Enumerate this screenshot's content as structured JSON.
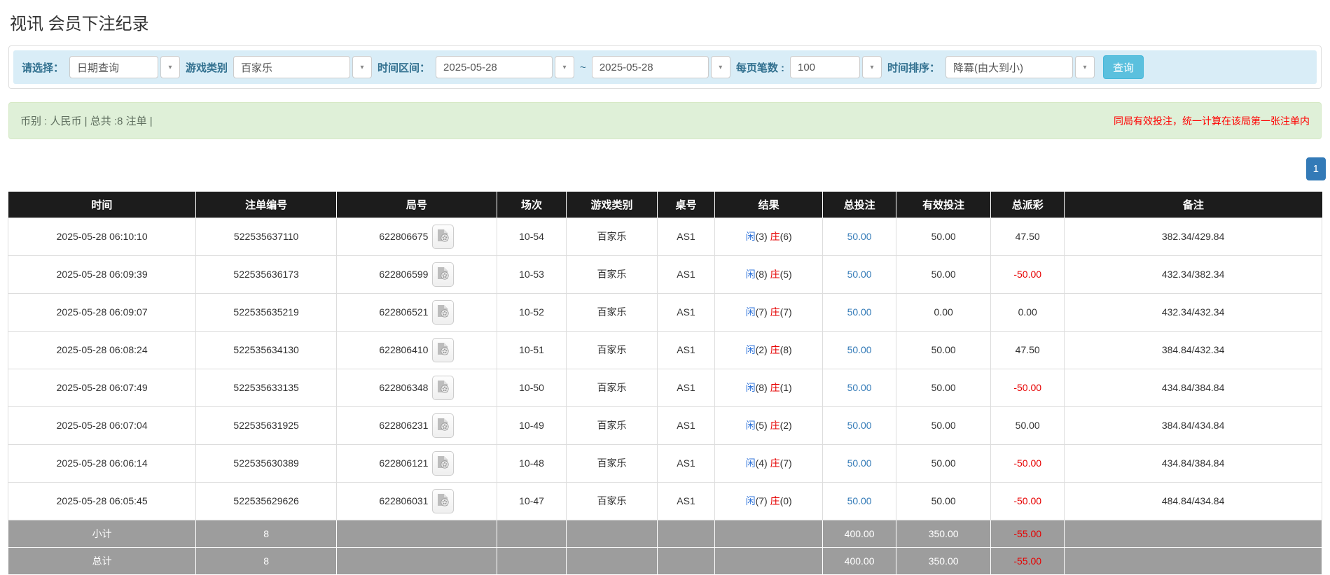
{
  "page": {
    "title": "视讯 会员下注纪录"
  },
  "filters": {
    "select_label": "请选择：",
    "select_value": "日期查询",
    "game_label": "游戏类别",
    "game_value": "百家乐",
    "range_label": "时间区间：",
    "date_from": "2025-05-28",
    "range_separator": "~",
    "date_to": "2025-05-28",
    "per_page_label": "每页笔数 :",
    "per_page_value": "100",
    "sort_label": "时间排序：",
    "sort_value": "降冪(由大到小)",
    "search_button": "查询"
  },
  "summary": {
    "left_text": "币别 : 人民币 | 总共 :8 注单 |",
    "right_note": "同局有效投注，统一计算在该局第一张注单内"
  },
  "pagination": {
    "current_page": "1"
  },
  "icons": {
    "caret": "▾",
    "video_icon_name": "video-record-icon"
  },
  "colors": {
    "filter_bg": "#d9edf7",
    "accent_blue": "#5bc0de",
    "link_blue": "#337ab7",
    "player_blue": "#2d72d9",
    "banker_red": "#e60000",
    "negative_red": "#e60000",
    "summary_bg": "#dff0d8",
    "note_red": "#ff0000",
    "header_bg": "#1c1c1c",
    "footer_bg": "#9d9d9d",
    "pagination_blue": "#337ab7"
  },
  "table": {
    "headers": [
      "时间",
      "注单编号",
      "局号",
      "场次",
      "游戏类别",
      "桌号",
      "结果",
      "总投注",
      "有效投注",
      "总派彩",
      "备注"
    ],
    "result_player_label": "闲",
    "result_banker_label": "庄",
    "rows": [
      {
        "time": "2025-05-28 06:10:10",
        "bet_id": "522535637110",
        "round_id": "622806675",
        "session": "10-54",
        "game": "百家乐",
        "table": "AS1",
        "player_num": "3",
        "banker_num": "6",
        "total_bet": "50.00",
        "valid_bet": "50.00",
        "payout": "47.50",
        "remark": "382.34/429.84"
      },
      {
        "time": "2025-05-28 06:09:39",
        "bet_id": "522535636173",
        "round_id": "622806599",
        "session": "10-53",
        "game": "百家乐",
        "table": "AS1",
        "player_num": "8",
        "banker_num": "5",
        "total_bet": "50.00",
        "valid_bet": "50.00",
        "payout": "-50.00",
        "remark": "432.34/382.34"
      },
      {
        "time": "2025-05-28 06:09:07",
        "bet_id": "522535635219",
        "round_id": "622806521",
        "session": "10-52",
        "game": "百家乐",
        "table": "AS1",
        "player_num": "7",
        "banker_num": "7",
        "total_bet": "50.00",
        "valid_bet": "0.00",
        "payout": "0.00",
        "remark": "432.34/432.34"
      },
      {
        "time": "2025-05-28 06:08:24",
        "bet_id": "522535634130",
        "round_id": "622806410",
        "session": "10-51",
        "game": "百家乐",
        "table": "AS1",
        "player_num": "2",
        "banker_num": "8",
        "total_bet": "50.00",
        "valid_bet": "50.00",
        "payout": "47.50",
        "remark": "384.84/432.34"
      },
      {
        "time": "2025-05-28 06:07:49",
        "bet_id": "522535633135",
        "round_id": "622806348",
        "session": "10-50",
        "game": "百家乐",
        "table": "AS1",
        "player_num": "8",
        "banker_num": "1",
        "total_bet": "50.00",
        "valid_bet": "50.00",
        "payout": "-50.00",
        "remark": "434.84/384.84"
      },
      {
        "time": "2025-05-28 06:07:04",
        "bet_id": "522535631925",
        "round_id": "622806231",
        "session": "10-49",
        "game": "百家乐",
        "table": "AS1",
        "player_num": "5",
        "banker_num": "2",
        "total_bet": "50.00",
        "valid_bet": "50.00",
        "payout": "50.00",
        "remark": "384.84/434.84"
      },
      {
        "time": "2025-05-28 06:06:14",
        "bet_id": "522535630389",
        "round_id": "622806121",
        "session": "10-48",
        "game": "百家乐",
        "table": "AS1",
        "player_num": "4",
        "banker_num": "7",
        "total_bet": "50.00",
        "valid_bet": "50.00",
        "payout": "-50.00",
        "remark": "434.84/384.84"
      },
      {
        "time": "2025-05-28 06:05:45",
        "bet_id": "522535629626",
        "round_id": "622806031",
        "session": "10-47",
        "game": "百家乐",
        "table": "AS1",
        "player_num": "7",
        "banker_num": "0",
        "total_bet": "50.00",
        "valid_bet": "50.00",
        "payout": "-50.00",
        "remark": "484.84/434.84"
      }
    ],
    "footer": [
      {
        "label": "小计",
        "count": "8",
        "total_bet": "400.00",
        "valid_bet": "350.00",
        "payout": "-55.00",
        "remark": ""
      },
      {
        "label": "总计",
        "count": "8",
        "total_bet": "400.00",
        "valid_bet": "350.00",
        "payout": "-55.00",
        "remark": ""
      }
    ]
  }
}
